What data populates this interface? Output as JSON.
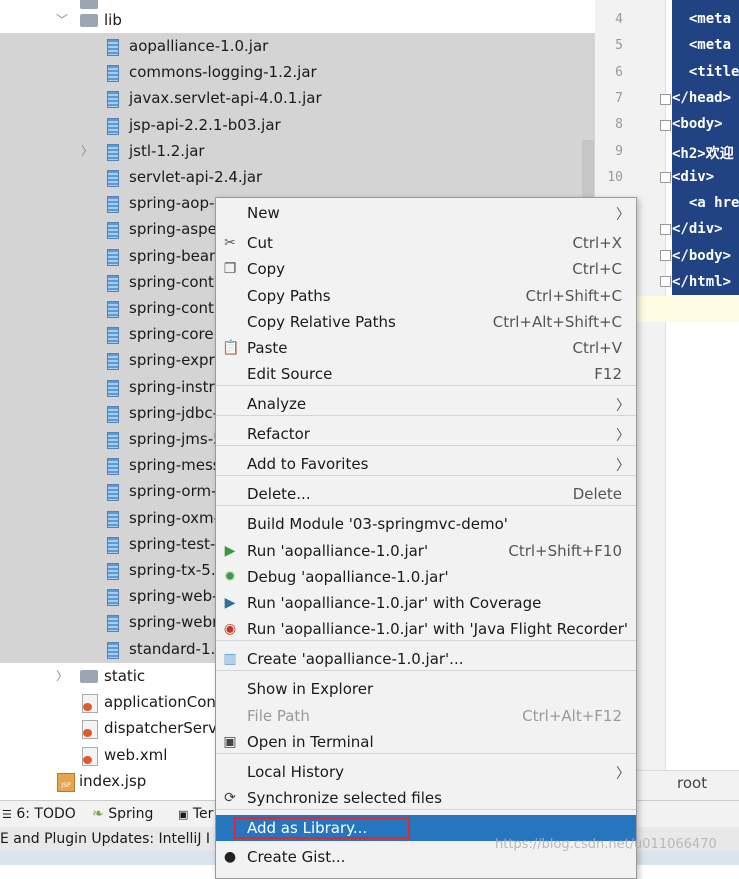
{
  "tree": {
    "lib_folder": "lib",
    "jars": [
      "aopalliance-1.0.jar",
      "commons-logging-1.2.jar",
      "javax.servlet-api-4.0.1.jar",
      "jsp-api-2.2.1-b03.jar",
      "jstl-1.2.jar",
      "servlet-api-2.4.jar",
      "spring-aop-",
      "spring-aspe",
      "spring-bean",
      "spring-cont",
      "spring-cont",
      "spring-core",
      "spring-expr",
      "spring-instr",
      "spring-jdbc-",
      "spring-jms-5",
      "spring-mess",
      "spring-orm-",
      "spring-oxm-",
      "spring-test-",
      "spring-tx-5.",
      "spring-web-",
      "spring-webr",
      "standard-1.1"
    ],
    "static_folder": "static",
    "files": [
      "applicationCon",
      "dispatcherServl",
      "web.xml"
    ],
    "index": "index.jsp"
  },
  "editor": {
    "line_numbers": [
      "4",
      "5",
      "6",
      "7",
      "8",
      "9",
      "10"
    ],
    "code_lines": [
      "  <meta",
      "  <meta",
      "  <title",
      "</head>",
      "<body>",
      "<h2>欢迎",
      "<div>",
      "  <a hre",
      "</div>",
      "</body>",
      "</html>"
    ]
  },
  "menu": {
    "items": [
      {
        "label": "New",
        "shortcut": "",
        "submenu": true,
        "icon": ""
      },
      {
        "label": "Cut",
        "shortcut": "Ctrl+X",
        "icon": "scissors-icon"
      },
      {
        "label": "Copy",
        "shortcut": "Ctrl+C",
        "icon": "copy-icon"
      },
      {
        "label": "Copy Paths",
        "shortcut": "Ctrl+Shift+C"
      },
      {
        "label": "Copy Relative Paths",
        "shortcut": "Ctrl+Alt+Shift+C"
      },
      {
        "label": "Paste",
        "shortcut": "Ctrl+V",
        "icon": "clipboard-icon"
      },
      {
        "label": "Edit Source",
        "shortcut": "F12"
      },
      {
        "label": "Analyze",
        "submenu": true
      },
      {
        "label": "Refactor",
        "submenu": true
      },
      {
        "label": "Add to Favorites",
        "submenu": true
      },
      {
        "label": "Delete...",
        "shortcut": "Delete"
      },
      {
        "label": "Build Module '03-springmvc-demo'"
      },
      {
        "label": "Run 'aopalliance-1.0.jar'",
        "shortcut": "Ctrl+Shift+F10",
        "icon": "run-icon"
      },
      {
        "label": "Debug 'aopalliance-1.0.jar'",
        "icon": "debug-icon"
      },
      {
        "label": "Run 'aopalliance-1.0.jar' with Coverage",
        "icon": "coverage-icon"
      },
      {
        "label": "Run 'aopalliance-1.0.jar' with 'Java Flight Recorder'",
        "icon": "flight-recorder-icon"
      },
      {
        "label": "Create 'aopalliance-1.0.jar'...",
        "icon": "jar-icon"
      },
      {
        "label": "Show in Explorer"
      },
      {
        "label": "File Path",
        "shortcut": "Ctrl+Alt+F12",
        "disabled": true
      },
      {
        "label": "Open in Terminal",
        "icon": "terminal-icon"
      },
      {
        "label": "Local History",
        "submenu": true
      },
      {
        "label": "Synchronize selected files",
        "icon": "sync-icon"
      },
      {
        "label": "Add as Library...",
        "selected": true
      },
      {
        "label": "Create Gist...",
        "icon": "github-icon"
      }
    ]
  },
  "toolwindows": {
    "todo": "6: TODO",
    "spring": "Spring",
    "terminal": "Ter"
  },
  "status": "E and Plugin Updates: IntelliJ I",
  "root_label": "root",
  "watermark": "https://blog.csdn.net/u011066470"
}
